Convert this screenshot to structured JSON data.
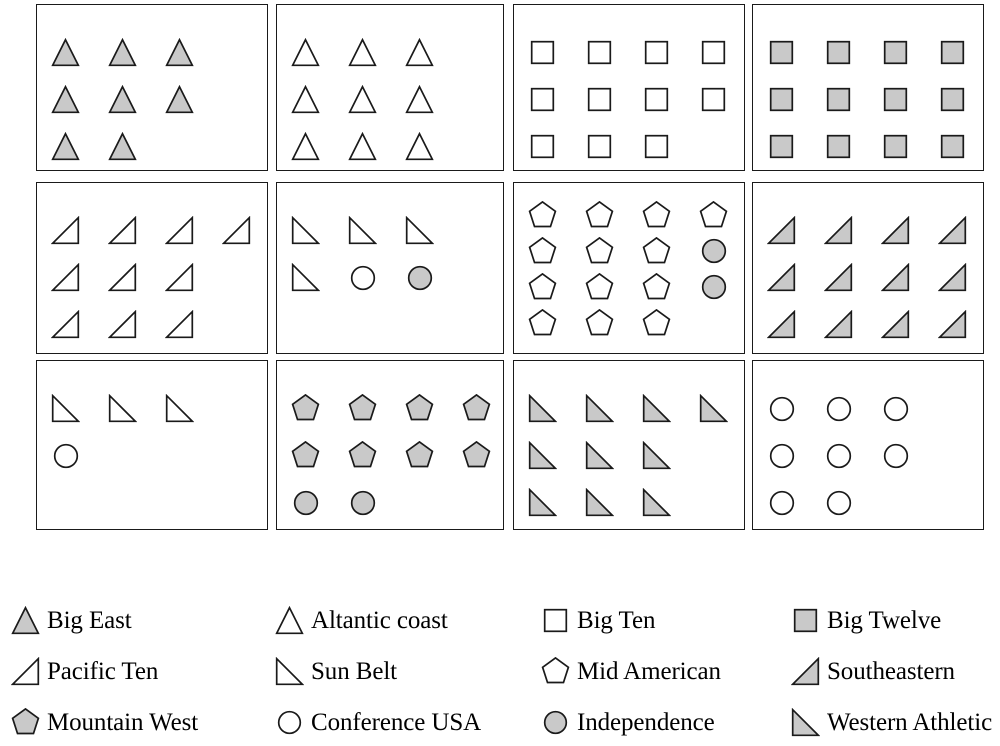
{
  "figure": {
    "type": "categorical-symbol-grid",
    "panel_rows": 3,
    "panel_cols": 4,
    "fill_color": "#c9c9c9",
    "stroke_color": "#1a1a1a",
    "background": "#ffffff"
  },
  "legend": {
    "rows": [
      [
        {
          "shape": "filled-triangle-up-icon",
          "label": "Big East"
        },
        {
          "shape": "open-triangle-up-icon",
          "label": "Altantic coast"
        },
        {
          "shape": "open-square-icon",
          "label": "Big Ten"
        },
        {
          "shape": "filled-square-icon",
          "label": "Big Twelve"
        }
      ],
      [
        {
          "shape": "open-right-triangle-up-icon",
          "label": "Pacific Ten"
        },
        {
          "shape": "open-right-triangle-down-icon",
          "label": "Sun Belt"
        },
        {
          "shape": "open-pentagon-icon",
          "label": "Mid American"
        },
        {
          "shape": "filled-right-triangle-up-icon",
          "label": "Southeastern"
        }
      ],
      [
        {
          "shape": "filled-pentagon-icon",
          "label": "Mountain West"
        },
        {
          "shape": "open-circle-icon",
          "label": "Conference USA"
        },
        {
          "shape": "filled-circle-icon",
          "label": "Independence"
        },
        {
          "shape": "filled-right-triangle-down-icon",
          "label": "Western Athletic"
        }
      ]
    ]
  },
  "panels": [
    {
      "index": 1,
      "name": "panel-1",
      "rows": [
        [
          "filled-triangle-up",
          "filled-triangle-up",
          "filled-triangle-up"
        ],
        [
          "filled-triangle-up",
          "filled-triangle-up",
          "filled-triangle-up"
        ],
        [
          "filled-triangle-up",
          "filled-triangle-up"
        ]
      ],
      "counts": {
        "Big East": 8
      }
    },
    {
      "index": 2,
      "name": "panel-2",
      "rows": [
        [
          "open-triangle-up",
          "open-triangle-up",
          "open-triangle-up"
        ],
        [
          "open-triangle-up",
          "open-triangle-up",
          "open-triangle-up"
        ],
        [
          "open-triangle-up",
          "open-triangle-up",
          "open-triangle-up"
        ]
      ],
      "counts": {
        "Altantic coast": 9
      }
    },
    {
      "index": 3,
      "name": "panel-3",
      "rows": [
        [
          "open-square",
          "open-square",
          "open-square",
          "open-square"
        ],
        [
          "open-square",
          "open-square",
          "open-square",
          "open-square"
        ],
        [
          "open-square",
          "open-square",
          "open-square"
        ]
      ],
      "counts": {
        "Big Ten": 11
      }
    },
    {
      "index": 4,
      "name": "panel-4",
      "rows": [
        [
          "filled-square",
          "filled-square",
          "filled-square",
          "filled-square"
        ],
        [
          "filled-square",
          "filled-square",
          "filled-square",
          "filled-square"
        ],
        [
          "filled-square",
          "filled-square",
          "filled-square",
          "filled-square"
        ]
      ],
      "counts": {
        "Big Twelve": 12
      }
    },
    {
      "index": 5,
      "name": "panel-5",
      "rows": [
        [
          "open-right-triangle-up",
          "open-right-triangle-up",
          "open-right-triangle-up",
          "open-right-triangle-up"
        ],
        [
          "open-right-triangle-up",
          "open-right-triangle-up",
          "open-right-triangle-up"
        ],
        [
          "open-right-triangle-up",
          "open-right-triangle-up",
          "open-right-triangle-up"
        ]
      ],
      "counts": {
        "Pacific Ten": 10
      }
    },
    {
      "index": 6,
      "name": "panel-6",
      "rows": [
        [
          "open-right-triangle-down",
          "open-right-triangle-down",
          "open-right-triangle-down"
        ],
        [
          "open-right-triangle-down",
          "open-circle",
          "filled-circle"
        ]
      ],
      "counts": {
        "Sun Belt": 4,
        "Conference USA": 1,
        "Independence": 1
      }
    },
    {
      "index": 7,
      "name": "panel-7",
      "rows": [
        [
          "open-pentagon",
          "open-pentagon",
          "open-pentagon",
          "open-pentagon"
        ],
        [
          "open-pentagon",
          "open-pentagon",
          "open-pentagon",
          "filled-circle"
        ],
        [
          "open-pentagon",
          "open-pentagon",
          "open-pentagon",
          "filled-circle"
        ],
        [
          "open-pentagon",
          "open-pentagon",
          "open-pentagon"
        ]
      ],
      "counts": {
        "Mid American": 13,
        "Independence": 2
      }
    },
    {
      "index": 8,
      "name": "panel-8",
      "rows": [
        [
          "filled-right-triangle-up",
          "filled-right-triangle-up",
          "filled-right-triangle-up",
          "filled-right-triangle-up"
        ],
        [
          "filled-right-triangle-up",
          "filled-right-triangle-up",
          "filled-right-triangle-up",
          "filled-right-triangle-up"
        ],
        [
          "filled-right-triangle-up",
          "filled-right-triangle-up",
          "filled-right-triangle-up",
          "filled-right-triangle-up"
        ]
      ],
      "counts": {
        "Southeastern": 12
      }
    },
    {
      "index": 9,
      "name": "panel-9",
      "rows": [
        [
          "open-right-triangle-down",
          "open-right-triangle-down",
          "open-right-triangle-down"
        ],
        [
          "open-circle"
        ]
      ],
      "counts": {
        "Sun Belt": 3,
        "Conference USA": 1
      }
    },
    {
      "index": 10,
      "name": "panel-10",
      "rows": [
        [
          "filled-pentagon",
          "filled-pentagon",
          "filled-pentagon",
          "filled-pentagon"
        ],
        [
          "filled-pentagon",
          "filled-pentagon",
          "filled-pentagon",
          "filled-pentagon"
        ],
        [
          "filled-circle",
          "filled-circle"
        ]
      ],
      "counts": {
        "Mountain West": 8,
        "Independence": 2
      }
    },
    {
      "index": 11,
      "name": "panel-11",
      "rows": [
        [
          "filled-right-triangle-down",
          "filled-right-triangle-down",
          "filled-right-triangle-down",
          "filled-right-triangle-down"
        ],
        [
          "filled-right-triangle-down",
          "filled-right-triangle-down",
          "filled-right-triangle-down"
        ],
        [
          "filled-right-triangle-down",
          "filled-right-triangle-down",
          "filled-right-triangle-down"
        ]
      ],
      "counts": {
        "Western Athletic": 10
      }
    },
    {
      "index": 12,
      "name": "panel-12",
      "rows": [
        [
          "open-circle",
          "open-circle",
          "open-circle"
        ],
        [
          "open-circle",
          "open-circle",
          "open-circle"
        ],
        [
          "open-circle",
          "open-circle"
        ]
      ],
      "counts": {
        "Conference USA": 8
      }
    }
  ]
}
